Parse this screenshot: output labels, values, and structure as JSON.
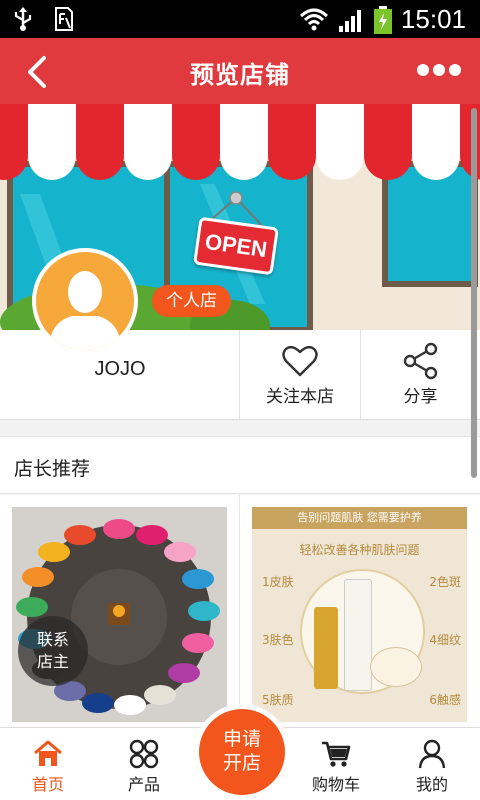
{
  "status_bar": {
    "time": "15:01",
    "colors": {
      "bg": "#000000",
      "battery": "#7cc42c"
    }
  },
  "header": {
    "title": "预览店铺",
    "bg_color": "#e03a3e"
  },
  "banner": {
    "sign_text": "OPEN"
  },
  "shop": {
    "type_badge": "个人店",
    "name": "JOJO"
  },
  "actions": {
    "follow_label": "关注本店",
    "share_label": "分享"
  },
  "section": {
    "title": "店长推荐"
  },
  "products": {
    "card2": {
      "banner_text": "告别问题肌肤 您需要护养",
      "subtitle": "轻松改善各种肌肤问题",
      "labels": [
        "1皮肤",
        "2色斑",
        "3肤色",
        "4细纹",
        "5肤质",
        "6触感"
      ]
    }
  },
  "contact": {
    "line1": "联系",
    "line2": "店主"
  },
  "bottom_nav": {
    "accent": "#f2561d",
    "items": [
      {
        "label": "首页",
        "icon": "home-icon",
        "active": true
      },
      {
        "label": "产品",
        "icon": "grid-icon",
        "active": false
      },
      {
        "label": "购物车",
        "icon": "cart-icon",
        "active": false
      },
      {
        "label": "我的",
        "icon": "user-icon",
        "active": false
      }
    ],
    "apply": {
      "line1": "申请",
      "line2": "开店"
    }
  }
}
